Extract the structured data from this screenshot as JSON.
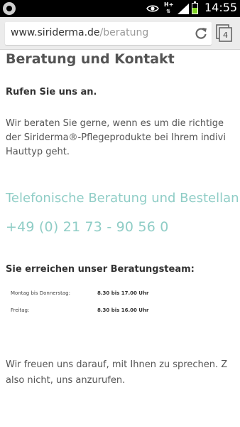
{
  "status_bar": {
    "network_type": "H+",
    "time": "14:55",
    "battery_level": 0.55,
    "icons": [
      "chrome-icon",
      "eye-icon",
      "network-type-icon",
      "signal-icon",
      "battery-icon"
    ]
  },
  "browser": {
    "url_domain": "www.siriderma.de",
    "url_path": "/beratung",
    "tab_count": "4",
    "icons": [
      "reload-icon",
      "tabs-icon"
    ]
  },
  "page": {
    "title": "Beratung und Kontakt",
    "call_heading": "Rufen Sie uns an.",
    "intro_lines": [
      "Wir beraten Sie gerne, wenn es um die richtige",
      "der Siriderma®-Pflegeprodukte bei Ihrem indivi",
      "Hauttyp geht."
    ],
    "phone_heading": "Telefonische Beratung und Bestellan",
    "phone_number": "+49 (0) 21 73 - 90 56 0",
    "team_heading": "Sie erreichen unser Beratungsteam:",
    "hours": [
      {
        "day": "Montag bis Donnerstag:",
        "time": "8.30 bis 17.00 Uhr"
      },
      {
        "day": "Freitag:",
        "time": "8.30 bis 16.00 Uhr"
      }
    ],
    "closing_lines": [
      "Wir freuen uns darauf, mit Ihnen zu sprechen. Z",
      "also nicht, uns anzurufen."
    ]
  },
  "colors": {
    "accent_teal": "#8fcdc6",
    "heading_gray": "#545454",
    "text_gray": "#555555"
  }
}
